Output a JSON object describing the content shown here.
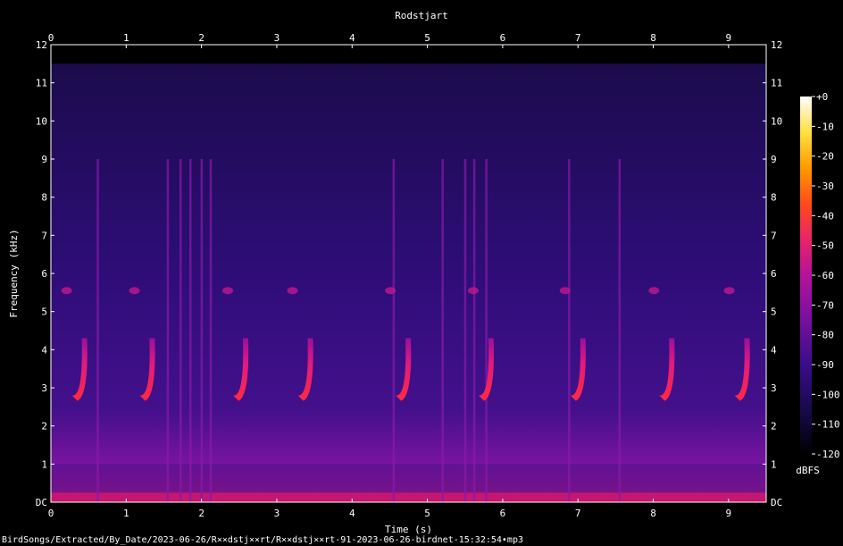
{
  "chart_data": {
    "type": "heatmap",
    "title": "Rodstjart",
    "xlabel": "Time (s)",
    "ylabel": "Frequency (kHz)",
    "xlim": [
      0,
      9.5
    ],
    "ylim": [
      0,
      12
    ],
    "x_ticks": [
      {
        "value": 0,
        "label": "0"
      },
      {
        "value": 1,
        "label": "1"
      },
      {
        "value": 2,
        "label": "2"
      },
      {
        "value": 3,
        "label": "3"
      },
      {
        "value": 4,
        "label": "4"
      },
      {
        "value": 5,
        "label": "5"
      },
      {
        "value": 6,
        "label": "6"
      },
      {
        "value": 7,
        "label": "7"
      },
      {
        "value": 8,
        "label": "8"
      },
      {
        "value": 9,
        "label": "9"
      }
    ],
    "y_ticks": [
      {
        "value": 0,
        "label": "DC"
      },
      {
        "value": 1,
        "label": "1"
      },
      {
        "value": 2,
        "label": "2"
      },
      {
        "value": 3,
        "label": "3"
      },
      {
        "value": 4,
        "label": "4"
      },
      {
        "value": 5,
        "label": "5"
      },
      {
        "value": 6,
        "label": "6"
      },
      {
        "value": 7,
        "label": "7"
      },
      {
        "value": 8,
        "label": "8"
      },
      {
        "value": 9,
        "label": "9"
      },
      {
        "value": 10,
        "label": "10"
      },
      {
        "value": 11,
        "label": "11"
      },
      {
        "value": 12,
        "label": "12"
      }
    ],
    "colorbar": {
      "label": "dBFS",
      "range": [
        -120,
        0
      ],
      "ticks": [
        {
          "value": 0,
          "label": "+0"
        },
        {
          "value": -10,
          "label": "-10"
        },
        {
          "value": -20,
          "label": "-20"
        },
        {
          "value": -30,
          "label": "-30"
        },
        {
          "value": -40,
          "label": "-40"
        },
        {
          "value": -50,
          "label": "-50"
        },
        {
          "value": -60,
          "label": "-60"
        },
        {
          "value": -70,
          "label": "-70"
        },
        {
          "value": -80,
          "label": "-80"
        },
        {
          "value": -90,
          "label": "-90"
        },
        {
          "value": -100,
          "label": "-100"
        },
        {
          "value": -110,
          "label": "-110"
        },
        {
          "value": -120,
          "label": "-120"
        }
      ],
      "colors": [
        "#000000",
        "#160a4a",
        "#3a0c8a",
        "#7a10a0",
        "#b5129a",
        "#e8246a",
        "#ff4a1a",
        "#ff9a00",
        "#ffe040",
        "#ffffff"
      ]
    },
    "bird_calls": [
      {
        "start_s": 0.28,
        "end_s": 0.48,
        "freq_low_khz": 2.8,
        "freq_high_khz": 4.3
      },
      {
        "start_s": 1.18,
        "end_s": 1.38,
        "freq_low_khz": 2.8,
        "freq_high_khz": 4.3
      },
      {
        "start_s": 2.42,
        "end_s": 2.62,
        "freq_low_khz": 2.8,
        "freq_high_khz": 4.3
      },
      {
        "start_s": 3.28,
        "end_s": 3.48,
        "freq_low_khz": 2.8,
        "freq_high_khz": 4.3
      },
      {
        "start_s": 4.58,
        "end_s": 4.78,
        "freq_low_khz": 2.8,
        "freq_high_khz": 4.3
      },
      {
        "start_s": 5.68,
        "end_s": 5.88,
        "freq_low_khz": 2.8,
        "freq_high_khz": 4.3
      },
      {
        "start_s": 6.9,
        "end_s": 7.1,
        "freq_low_khz": 2.8,
        "freq_high_khz": 4.3
      },
      {
        "start_s": 8.08,
        "end_s": 8.28,
        "freq_low_khz": 2.8,
        "freq_high_khz": 4.3
      },
      {
        "start_s": 9.08,
        "end_s": 9.28,
        "freq_low_khz": 2.8,
        "freq_high_khz": 4.3
      }
    ],
    "clicks_s": [
      0.62,
      1.55,
      1.72,
      1.85,
      2.0,
      2.12,
      4.55,
      5.2,
      5.5,
      5.62,
      5.78,
      6.88,
      7.55
    ]
  },
  "footer": {
    "file_path": "BirdSongs/Extracted/By_Date/2023-06-26/R××dstj××rt/R××dstj××rt-91-2023-06-26-birdnet-15:32:54•mp3"
  }
}
